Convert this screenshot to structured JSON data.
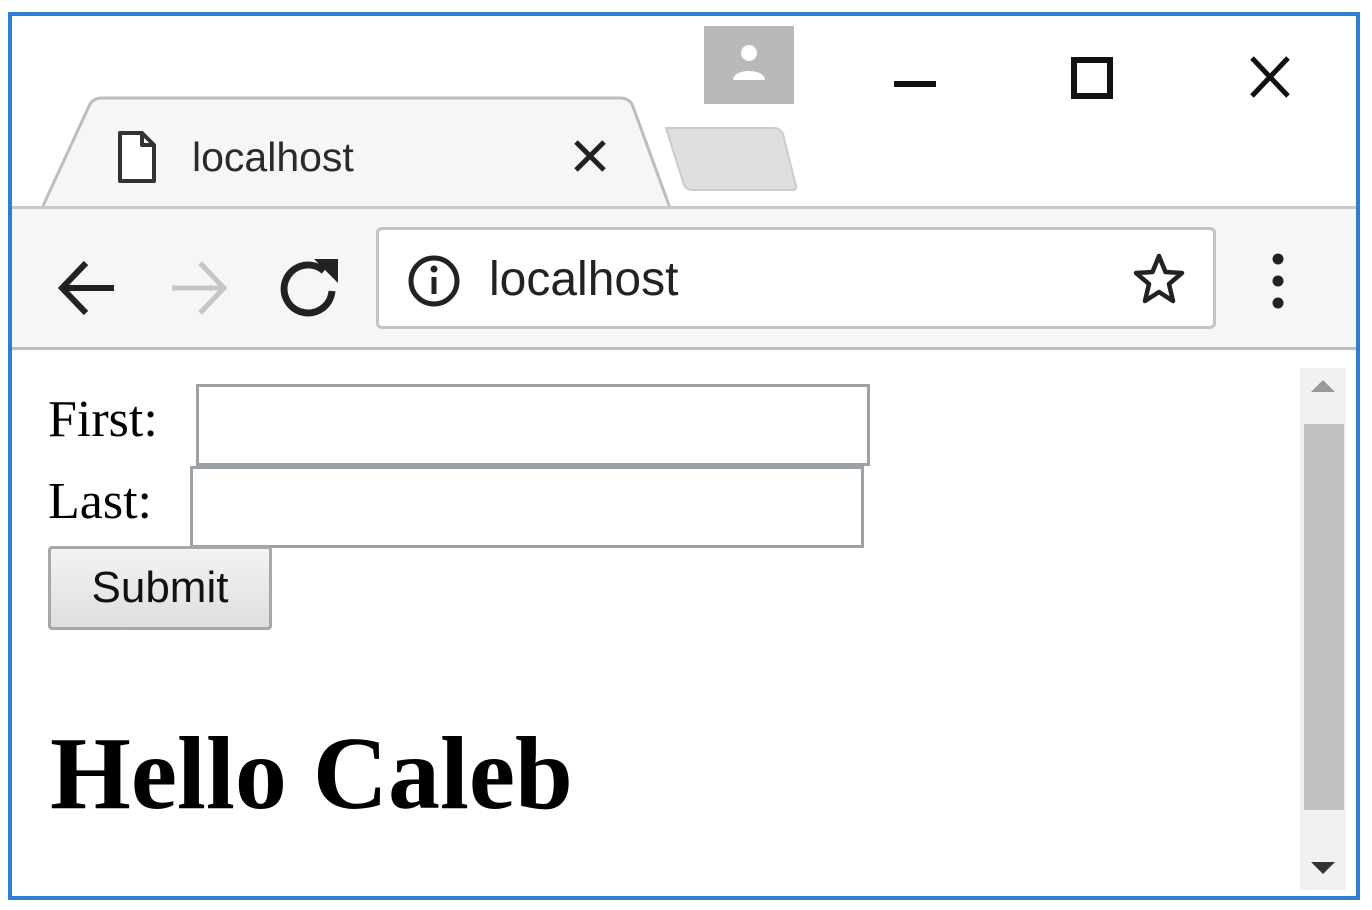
{
  "tab": {
    "title": "localhost",
    "doc_icon": "page-icon",
    "close_icon": "close-icon"
  },
  "window_controls": {
    "profile_icon": "person-icon",
    "minimize_icon": "minimize-icon",
    "maximize_icon": "maximize-icon",
    "close_icon": "close-icon"
  },
  "toolbar": {
    "back_icon": "arrow-left-icon",
    "forward_icon": "arrow-right-icon",
    "reload_icon": "reload-icon",
    "address": {
      "info_icon": "info-icon",
      "url": "localhost",
      "bookmark_icon": "star-icon"
    },
    "menu_icon": "kebab-menu-icon"
  },
  "form": {
    "first_label": "First:",
    "first_value": "",
    "last_label": "Last:",
    "last_value": "",
    "submit_label": "Submit"
  },
  "greeting": "Hello Caleb",
  "colors": {
    "window_border": "#2b7fd6",
    "toolbar_bg": "#f6f6f6",
    "profile_bg": "#b9b9b9",
    "scroll_thumb": "#c1c1c1"
  }
}
